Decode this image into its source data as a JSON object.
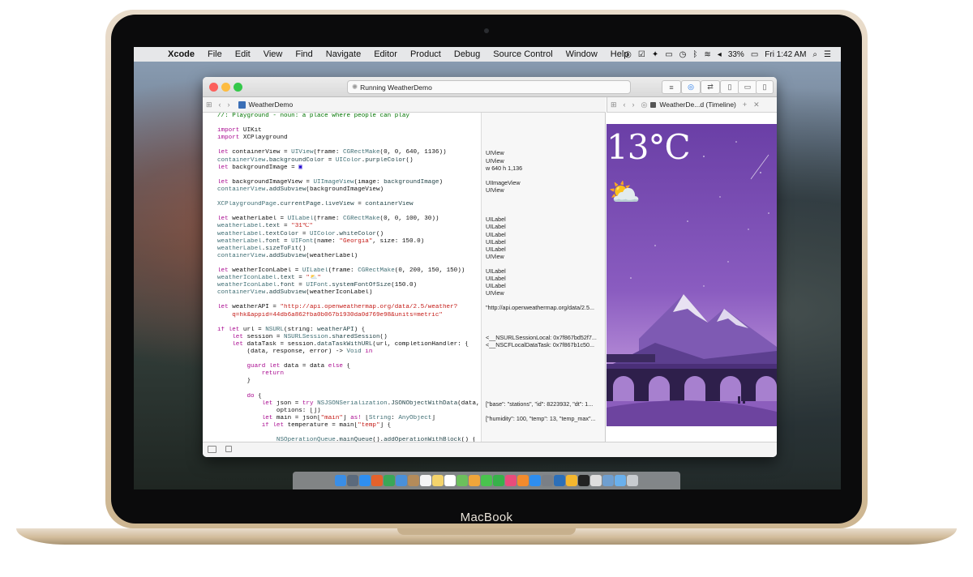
{
  "menubar": {
    "app": "Xcode",
    "items": [
      "File",
      "Edit",
      "View",
      "Find",
      "Navigate",
      "Editor",
      "Product",
      "Debug",
      "Source Control",
      "Window",
      "Help"
    ],
    "battery": "33%",
    "clock": "Fri 1:42 AM"
  },
  "window": {
    "activity": "Running WeatherDemo",
    "editor_tab": "WeatherDemo",
    "assistant_tab": "WeatherDe...d (Timeline)"
  },
  "code_lines": [
    [
      [
        "cm",
        "//: Playground - noun: a place where people can play"
      ]
    ],
    [],
    [
      [
        "kw",
        "import"
      ],
      [
        "",
        " UIKit"
      ]
    ],
    [
      [
        "kw",
        "import"
      ],
      [
        "",
        " XCPlayground"
      ]
    ],
    [],
    [
      [
        "kw",
        "let"
      ],
      [
        "",
        " containerView = "
      ],
      [
        "ty",
        "UIView"
      ],
      [
        "",
        "(frame: "
      ],
      [
        "ty",
        "CGRectMake"
      ],
      [
        "",
        "(0, 0, 640, 1136))"
      ]
    ],
    [
      [
        "ty",
        "containerView"
      ],
      [
        "",
        "."
      ],
      [
        "fn",
        "backgroundColor"
      ],
      [
        "",
        " = "
      ],
      [
        "ty",
        "UIColor"
      ],
      [
        "",
        "."
      ],
      [
        "fn",
        "purpleColor"
      ],
      [
        "",
        "()"
      ]
    ],
    [
      [
        "kw",
        "let"
      ],
      [
        "",
        " backgroundImage = "
      ],
      [
        "num",
        "▣"
      ]
    ],
    [],
    [
      [
        "kw",
        "let"
      ],
      [
        "",
        " backgroundImageView = "
      ],
      [
        "ty",
        "UIImageView"
      ],
      [
        "",
        "(image: "
      ],
      [
        "fn",
        "backgroundImage"
      ],
      [
        "",
        ")"
      ]
    ],
    [
      [
        "ty",
        "containerView"
      ],
      [
        "",
        "."
      ],
      [
        "fn",
        "addSubview"
      ],
      [
        "",
        "(backgroundImageView)"
      ]
    ],
    [],
    [
      [
        "ty",
        "XCPlaygroundPage"
      ],
      [
        "",
        "."
      ],
      [
        "fn",
        "currentPage"
      ],
      [
        "",
        "."
      ],
      [
        "fn",
        "liveView"
      ],
      [
        "",
        " = "
      ],
      [
        "fn",
        "containerView"
      ]
    ],
    [],
    [
      [
        "kw",
        "let"
      ],
      [
        "",
        " weatherLabel = "
      ],
      [
        "ty",
        "UILabel"
      ],
      [
        "",
        "(frame: "
      ],
      [
        "ty",
        "CGRectMake"
      ],
      [
        "",
        "(0, 0, 100, 30))"
      ]
    ],
    [
      [
        "ty",
        "weatherLabel"
      ],
      [
        "",
        "."
      ],
      [
        "fn",
        "text"
      ],
      [
        "",
        " = "
      ],
      [
        "str",
        "\"31℃\""
      ]
    ],
    [
      [
        "ty",
        "weatherLabel"
      ],
      [
        "",
        "."
      ],
      [
        "fn",
        "textColor"
      ],
      [
        "",
        " = "
      ],
      [
        "ty",
        "UIColor"
      ],
      [
        "",
        "."
      ],
      [
        "fn",
        "whiteColor"
      ],
      [
        "",
        "()"
      ]
    ],
    [
      [
        "ty",
        "weatherLabel"
      ],
      [
        "",
        "."
      ],
      [
        "fn",
        "font"
      ],
      [
        "",
        " = "
      ],
      [
        "ty",
        "UIFont"
      ],
      [
        "",
        "(name: "
      ],
      [
        "str",
        "\"Georgia\""
      ],
      [
        "",
        ", size: 150.0)"
      ]
    ],
    [
      [
        "ty",
        "weatherLabel"
      ],
      [
        "",
        "."
      ],
      [
        "fn",
        "sizeToFit"
      ],
      [
        "",
        "()"
      ]
    ],
    [
      [
        "ty",
        "containerView"
      ],
      [
        "",
        "."
      ],
      [
        "fn",
        "addSubview"
      ],
      [
        "",
        "(weatherLabel)"
      ]
    ],
    [],
    [
      [
        "kw",
        "let"
      ],
      [
        "",
        " weatherIconLabel = "
      ],
      [
        "ty",
        "UILabel"
      ],
      [
        "",
        "(frame: "
      ],
      [
        "ty",
        "CGRectMake"
      ],
      [
        "",
        "(0, 200, 150, 150))"
      ]
    ],
    [
      [
        "ty",
        "weatherIconLabel"
      ],
      [
        "",
        "."
      ],
      [
        "fn",
        "text"
      ],
      [
        "",
        " = "
      ],
      [
        "str",
        "\"⛅\""
      ]
    ],
    [
      [
        "ty",
        "weatherIconLabel"
      ],
      [
        "",
        "."
      ],
      [
        "fn",
        "font"
      ],
      [
        "",
        " = "
      ],
      [
        "ty",
        "UIFont"
      ],
      [
        "",
        "."
      ],
      [
        "fn",
        "systemFontOfSize"
      ],
      [
        "",
        "(150.0)"
      ]
    ],
    [
      [
        "ty",
        "containerView"
      ],
      [
        "",
        "."
      ],
      [
        "fn",
        "addSubview"
      ],
      [
        "",
        "(weatherIconLabel)"
      ]
    ],
    [],
    [
      [
        "kw",
        "let"
      ],
      [
        "",
        " weatherAPI = "
      ],
      [
        "str",
        "\"http://api.openweathermap.org/data/2.5/weather?"
      ]
    ],
    [
      [
        "str",
        "    q=hk&appid=44db6a862fba0b067b1930da0d769e98&units=metric\""
      ]
    ],
    [],
    [
      [
        "kw",
        "if let"
      ],
      [
        "",
        " url = "
      ],
      [
        "ty",
        "NSURL"
      ],
      [
        "",
        "(string: "
      ],
      [
        "fn",
        "weatherAPI"
      ],
      [
        "",
        ") {"
      ]
    ],
    [
      [
        "",
        "    "
      ],
      [
        "kw",
        "let"
      ],
      [
        "",
        " session = "
      ],
      [
        "ty",
        "NSURLSession"
      ],
      [
        "",
        "."
      ],
      [
        "fn",
        "sharedSession"
      ],
      [
        "",
        "()"
      ]
    ],
    [
      [
        "",
        "    "
      ],
      [
        "kw",
        "let"
      ],
      [
        "",
        " dataTask = session."
      ],
      [
        "fn",
        "dataTaskWithURL"
      ],
      [
        "",
        "(url, completionHandler: {"
      ]
    ],
    [
      [
        "",
        "        (data, response, error) -> "
      ],
      [
        "ty",
        "Void"
      ],
      [
        "",
        " "
      ],
      [
        "kw",
        "in"
      ]
    ],
    [],
    [
      [
        "",
        "        "
      ],
      [
        "kw",
        "guard let"
      ],
      [
        "",
        " data = data "
      ],
      [
        "kw",
        "else"
      ],
      [
        "",
        " {"
      ]
    ],
    [
      [
        "",
        "            "
      ],
      [
        "kw",
        "return"
      ]
    ],
    [
      [
        "",
        "        }"
      ]
    ],
    [],
    [
      [
        "",
        "        "
      ],
      [
        "kw",
        "do"
      ],
      [
        "",
        " {"
      ]
    ],
    [
      [
        "",
        "            "
      ],
      [
        "kw",
        "let"
      ],
      [
        "",
        " json = "
      ],
      [
        "kw",
        "try"
      ],
      [
        "",
        " "
      ],
      [
        "ty",
        "NSJSONSerialization"
      ],
      [
        "",
        "."
      ],
      [
        "fn",
        "JSONObjectWithData"
      ],
      [
        "",
        "(data,"
      ]
    ],
    [
      [
        "",
        "                options: [])"
      ]
    ],
    [
      [
        "",
        "            "
      ],
      [
        "kw",
        "let"
      ],
      [
        "",
        " main = json["
      ],
      [
        "str",
        "\"main\""
      ],
      [
        "",
        "] "
      ],
      [
        "kw",
        "as!"
      ],
      [
        "",
        " ["
      ],
      [
        "ty",
        "String"
      ],
      [
        "",
        ": "
      ],
      [
        "ty",
        "AnyObject"
      ],
      [
        "",
        "]"
      ]
    ],
    [
      [
        "",
        "            "
      ],
      [
        "kw",
        "if let"
      ],
      [
        "",
        " temperature = main["
      ],
      [
        "str",
        "\"temp\""
      ],
      [
        "",
        "] {"
      ]
    ],
    [],
    [
      [
        "",
        "                "
      ],
      [
        "ty",
        "NSOperationQueue"
      ],
      [
        "",
        "."
      ],
      [
        "fn",
        "mainQueue"
      ],
      [
        "",
        "()."
      ],
      [
        "fn",
        "addOperationWithBlock"
      ],
      [
        "",
        "() {"
      ]
    ]
  ],
  "results": [
    "",
    "",
    "",
    "",
    "",
    "UIView",
    "UIView",
    "w 640 h 1,136",
    "",
    "UIImageView",
    "UIView",
    "",
    "",
    "",
    "UILabel",
    "UILabel",
    "UILabel",
    "UILabel",
    "UILabel",
    "UIView",
    "",
    "UILabel",
    "UILabel",
    "UILabel",
    "UIView",
    "",
    "\"http://api.openweathermap.org/data/2.5...",
    "",
    "",
    "",
    "<__NSURLSessionLocal: 0x7f867bd52f7...",
    "<__NSCFLocalDataTask: 0x7f867b1c50...",
    "",
    "",
    "",
    "",
    "",
    "",
    "",
    "[\"base\": \"stations\", \"id\": 8223932, \"dt\": 1...",
    "",
    "[\"humidity\": 100, \"temp\": 13, \"temp_max\"...",
    "",
    "",
    ""
  ],
  "liveview": {
    "temperature": "13°C",
    "weather_icon": "⛅"
  },
  "brand": "MacBook",
  "dock_icons": [
    {
      "name": "finder-icon",
      "color": "#3a8ee6"
    },
    {
      "name": "launchpad-icon",
      "color": "#5b6a7c"
    },
    {
      "name": "safari-icon",
      "color": "#2f8ff0"
    },
    {
      "name": "firefox-icon",
      "color": "#e4622b"
    },
    {
      "name": "chrome-icon",
      "color": "#3aa757"
    },
    {
      "name": "mail-icon",
      "color": "#4a90d9"
    },
    {
      "name": "contacts-icon",
      "color": "#b48b5a"
    },
    {
      "name": "calendar-icon",
      "color": "#f5f5f5"
    },
    {
      "name": "notes-icon",
      "color": "#f3d36b"
    },
    {
      "name": "reminders-icon",
      "color": "#ffffff"
    },
    {
      "name": "maps-icon",
      "color": "#6cbf5c"
    },
    {
      "name": "photos-icon",
      "color": "#f0a63a"
    },
    {
      "name": "messages-icon",
      "color": "#49c34e"
    },
    {
      "name": "facetime-icon",
      "color": "#37b14a"
    },
    {
      "name": "itunes-icon",
      "color": "#e84c7c"
    },
    {
      "name": "ibooks-icon",
      "color": "#f38b2c"
    },
    {
      "name": "appstore-icon",
      "color": "#2e8ef0"
    },
    {
      "name": "preferences-icon",
      "color": "#7a7f86"
    },
    {
      "name": "xcode-icon",
      "color": "#2c6fb8"
    },
    {
      "name": "sketch-icon",
      "color": "#f4b72f"
    },
    {
      "name": "terminal-icon",
      "color": "#222222"
    },
    {
      "name": "textedit-icon",
      "color": "#dedede"
    },
    {
      "name": "preview-icon",
      "color": "#6f9fd0"
    },
    {
      "name": "folder-icon",
      "color": "#6ab0ec"
    },
    {
      "name": "trash-icon",
      "color": "#c8ccd0"
    }
  ],
  "colors": {
    "purple_sky": "#6c3fa8",
    "keyword": "#aa0d91",
    "type": "#3f6e74",
    "string": "#c41a16",
    "comment": "#007400"
  }
}
